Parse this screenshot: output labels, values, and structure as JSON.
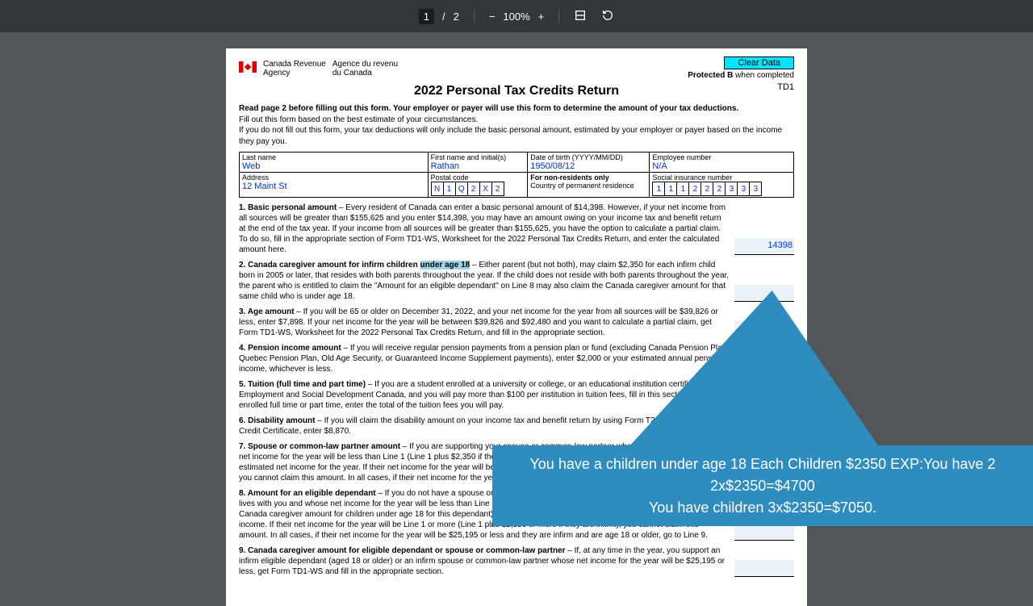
{
  "toolbar": {
    "page": "1",
    "total": "2",
    "zoom": "100%"
  },
  "agency": {
    "en1": "Canada Revenue",
    "en2": "Agency",
    "fr1": "Agence du revenu",
    "fr2": "du Canada"
  },
  "buttons": {
    "clear": "Clear Data"
  },
  "protected": {
    "b": "Protected B",
    "rest": " when completed"
  },
  "td1": "TD1",
  "title": "2022 Personal Tax Credits Return",
  "intro": {
    "bold": "Read page 2 before filling out this form. Your employer or payer will use this form to determine the amount of your tax deductions.",
    "l1": "Fill out this form based on the best estimate of your circumstances.",
    "l2": "If you do not fill out this form, your tax deductions will only include the basic personal amount, estimated by your employer or payer based on the income they pay you."
  },
  "labels": {
    "last": "Last name",
    "first": "First name and initial(s)",
    "dob": "Date of birth (YYYY/MM/DD)",
    "emp": "Employee number",
    "addr": "Address",
    "postal": "Postal code",
    "nonres": "For non-residents only",
    "country": "Country of permanent residence",
    "sin": "Social insurance number"
  },
  "values": {
    "last": "Web",
    "first": "Rathan",
    "dob": "1950/08/12",
    "emp": "N/A",
    "addr": "12 Maint St"
  },
  "postal": [
    "N",
    "1",
    "Q",
    "2",
    "X",
    "2"
  ],
  "sin": [
    "1",
    "1",
    "1",
    "2",
    "2",
    "2",
    "3",
    "3",
    "3"
  ],
  "items": {
    "n1": {
      "b": "1. Basic personal amount",
      "t": " – Every resident of Canada can enter a basic personal amount of $14,398. However, if your net income from all sources will be greater than $155,625 and you enter $14,398, you may have an amount owing on your income tax and benefit return at the end of the tax year. If your income from all sources will be greater than $155,625, you have the option to calculate a partial claim. To do so, fill in the appropriate section of Form TD1-WS, Worksheet for the 2022 Personal Tax Credits Return, and enter the calculated amount here.",
      "amt": "14398"
    },
    "n2": {
      "b": "2. Canada caregiver amount for infirm children ",
      "hl": "under age 18",
      "t": " – Either parent (but not both), may claim $2,350 for each infirm child born in 2005 or later, that resides with both parents throughout the year. If the child does not reside with both parents throughout the year, the parent who is entitled to claim the \"Amount for an eligible dependant\" on Line 8 may also claim the Canada caregiver amount for that same child who is under age 18."
    },
    "n3": {
      "b": "3. Age amount",
      "t": " – If you will be 65 or older on December 31, 2022, and your net income for the year from all sources will be $39,826 or less, enter $7,898. If your net income for the year will be between $39,826 and $92,480 and you want to calculate a partial claim, get Form TD1-WS, Worksheet for the 2022 Personal Tax Credits Return, and fill in the appropriate section."
    },
    "n4": {
      "b": "4. Pension income amount",
      "t": " – If you will receive regular pension payments from a pension plan or fund (excluding Canada Pension Plan, Quebec Pension Plan, Old Age Security, or Guaranteed Income Supplement payments), enter $2,000 or your estimated annual pension income, whichever is less."
    },
    "n5": {
      "b": "5. Tuition (full time and part time)",
      "t": " – If you are a student enrolled at a university or college, or an educational institution certified by Employment and Social Development Canada, and you will pay more than $100 per institution in tuition fees, fill in this section. If you are enrolled full time or part time, enter the total of the tuition fees you will pay."
    },
    "n6": {
      "b": "6. Disability amount",
      "t": " – If you will claim the disability amount on your income tax and benefit return by using Form T2201, Disability Tax Credit Certificate, enter $8,870."
    },
    "n7": {
      "b": "7. Spouse or common-law partner amount",
      "t": " – If you are supporting your spouse or common-law partner who lives with you and whose net income for the year will be less than Line 1 (Line 1 plus $2,350 if they are infirm), enter the difference between this amount and their estimated net income for the year. If their net income for the year will be Line 1 or more (Line 1 plus $2,350 or more if they are infirm), you cannot claim this amount. In all cases, if their net income for the year will be $25,195 or less and they are infirm, go to Line 9."
    },
    "n8": {
      "b": "8. Amount for an eligible dependant",
      "t": " – If you do not have a spouse or common-law partner and you support a dependent relative who lives with you and whose net income for the year will be less than Line 1 (Line 1 plus $2,350 if they are infirm and you cannot claim the Canada caregiver amount for children under age 18 for this dependant), enter the difference between this amount and their estimated net income. If their net income for the year will be Line 1 or more (Line 1 plus $2,350 or more if they are infirm), you cannot claim this amount. In all cases, if their net income for the year will be $25,195 or less and they are infirm and are age 18 or older, go to Line 9."
    },
    "n9": {
      "b": "9. Canada caregiver amount for eligible dependant or spouse or common-law partner",
      "t": " – If, at any time in the year, you support an infirm eligible dependant (aged 18 or older) or an infirm spouse or common-law partner whose net income for the year will be $25,195 or less, get Form TD1-WS and fill in the appropriate section."
    }
  },
  "callout": {
    "l1": "You have a children under age 18 Each Children $2350  EXP:You have 2",
    "l2": "2x$2350=$4700",
    "l3": "You have  children 3x$2350=$7050."
  }
}
